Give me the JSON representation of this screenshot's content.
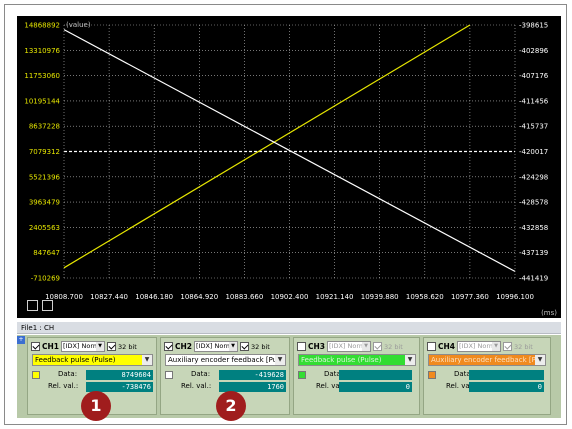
{
  "chart_data": {
    "type": "line",
    "xlabel": "(ms)",
    "ylabel_left": "(value)",
    "x_ticks": [
      "10808.700",
      "10827.440",
      "10846.180",
      "10864.920",
      "10883.660",
      "10902.400",
      "10921.140",
      "10939.880",
      "10958.620",
      "10977.360",
      "10996.100"
    ],
    "x_tick_values": [
      10808.7,
      10827.44,
      10846.18,
      10864.92,
      10883.66,
      10902.4,
      10921.14,
      10939.88,
      10958.62,
      10977.36,
      10996.1
    ],
    "xlim": [
      10808.7,
      10996.1
    ],
    "y_left_ticks": [
      "14868892",
      "13310976",
      "11753060",
      "10195144",
      "8637228",
      "7079312",
      "5521396",
      "3963479",
      "2405563",
      "847647",
      "-710269"
    ],
    "y_right_ticks": [
      "-398615",
      "-402896",
      "-407176",
      "-411456",
      "-415737",
      "-420017",
      "-424298",
      "-428578",
      "-432858",
      "-437139",
      "-441419"
    ],
    "ylim_left": [
      -710269,
      14868892
    ],
    "ylim_right": [
      -441419,
      -398615
    ],
    "grid": true,
    "series": [
      {
        "axis": "left",
        "color": "#e6e600",
        "x": [
          10808.7,
          10977.36
        ],
        "y": [
          -80000,
          14868892
        ]
      },
      {
        "axis": "right",
        "color": "#ffffff",
        "x": [
          10808.7,
          10996.1
        ],
        "y": [
          -399400,
          -440300
        ]
      }
    ]
  },
  "file_tab": "File1 : CH",
  "channels": [
    {
      "name": "CH1",
      "enabled": true,
      "mode": "[IDX] Norma",
      "bit_checked": true,
      "bit_label": "32 bit",
      "signal": "Feedback pulse (Pulse)",
      "signal_bg": "#ffff00",
      "swatch": "#ffff00",
      "data_label": "Data:",
      "data_value": "8749604",
      "rel_label": "Rel. val.:",
      "rel_value": "-738476"
    },
    {
      "name": "CH2",
      "enabled": true,
      "mode": "[IDX] Norma",
      "bit_checked": true,
      "bit_label": "32 bit",
      "signal": "Auxiliary encoder feedback [Pu",
      "signal_bg": "#ffffff",
      "swatch": "#ffffff",
      "data_label": "Data:",
      "data_value": "-419628",
      "rel_label": "Rel. val.:",
      "rel_value": "1760"
    },
    {
      "name": "CH3",
      "enabled": false,
      "mode": "[IDX] Norma",
      "bit_checked": true,
      "bit_label": "32 bit",
      "signal": "Feedback pulse (Pulse)",
      "signal_bg": "#33dd33",
      "swatch": "#33dd33",
      "data_label": "Data:",
      "data_value": "",
      "rel_label": "Rel. val.:",
      "rel_value": "0"
    },
    {
      "name": "CH4",
      "enabled": false,
      "mode": "[IDX] Norma",
      "bit_checked": true,
      "bit_label": "32 bit",
      "signal": "Auxiliary encoder feedback [Pu",
      "signal_bg": "#f08a1e",
      "swatch": "#f08a1e",
      "data_label": "Data:",
      "data_value": "",
      "rel_label": "Rel. val.:",
      "rel_value": "0"
    }
  ],
  "badges": [
    "1",
    "2"
  ],
  "icons": {
    "expander": "expand-icon",
    "combo_arrow": "chevron-down-icon",
    "corner_buttons": "window-toggle-icon"
  }
}
